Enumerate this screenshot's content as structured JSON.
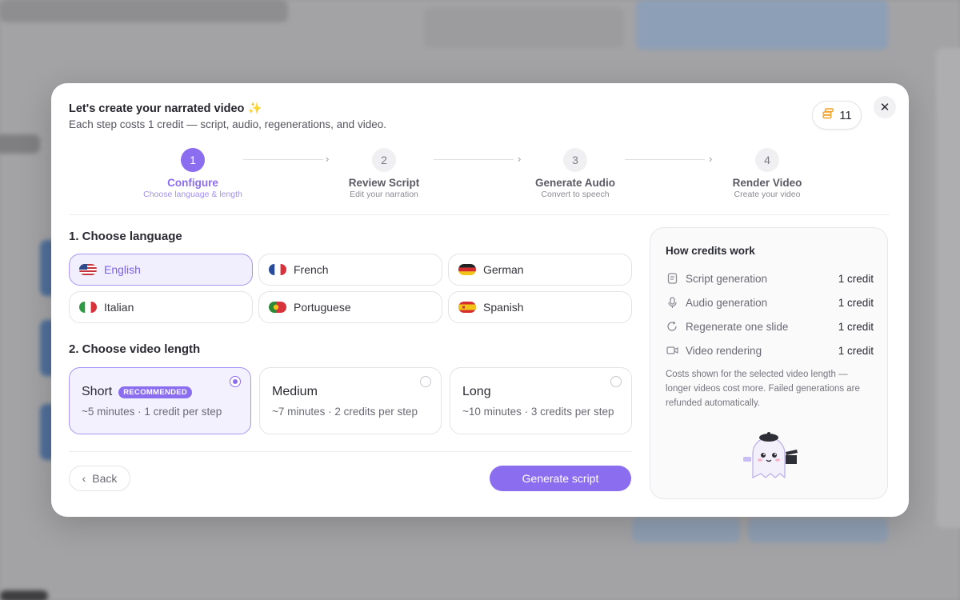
{
  "modal": {
    "title": "Let's create your narrated video ✨",
    "subtitle": "Each step costs 1 credit — script, audio, regenerations, and video.",
    "credits": "11",
    "close_icon": "close-icon"
  },
  "steps": [
    {
      "number": "1",
      "name": "Configure",
      "desc": "Choose language & length",
      "active": true
    },
    {
      "number": "2",
      "name": "Review Script",
      "desc": "Edit your narration",
      "active": false
    },
    {
      "number": "3",
      "name": "Generate Audio",
      "desc": "Convert to speech",
      "active": false
    },
    {
      "number": "4",
      "name": "Render Video",
      "desc": "Create your video",
      "active": false
    }
  ],
  "language": {
    "title": "1. Choose language",
    "options": [
      {
        "label": "English",
        "flag": "us-flag-icon",
        "selected": true
      },
      {
        "label": "French",
        "flag": "fr-flag-icon",
        "selected": false
      },
      {
        "label": "German",
        "flag": "de-flag-icon",
        "selected": false
      },
      {
        "label": "Italian",
        "flag": "it-flag-icon",
        "selected": false
      },
      {
        "label": "Portuguese",
        "flag": "pt-flag-icon",
        "selected": false
      },
      {
        "label": "Spanish",
        "flag": "es-flag-icon",
        "selected": false
      }
    ]
  },
  "length": {
    "title": "2. Choose video length",
    "options": [
      {
        "label": "Short",
        "badge": "RECOMMENDED",
        "desc": "~5 minutes · 1 credit per step",
        "selected": true
      },
      {
        "label": "Medium",
        "desc": "~7 minutes · 2 credits per step",
        "selected": false
      },
      {
        "label": "Long",
        "desc": "~10 minutes · 3 credits per step",
        "selected": false
      }
    ]
  },
  "footer": {
    "back_label": "Back",
    "generate_label": "Generate script"
  },
  "credits_panel": {
    "title": "How credits work",
    "rows": [
      {
        "label": "Script generation",
        "cost": "1 credit",
        "icon": "document-icon"
      },
      {
        "label": "Audio generation",
        "cost": "1 credit",
        "icon": "microphone-icon"
      },
      {
        "label": "Regenerate one slide",
        "cost": "1 credit",
        "icon": "refresh-icon"
      },
      {
        "label": "Video rendering",
        "cost": "1 credit",
        "icon": "video-camera-icon"
      }
    ],
    "note": "Costs shown for the selected video length — longer videos cost more. Failed generations are refunded automatically."
  },
  "colors": {
    "accent": "#8b6df0",
    "selected_bg": "#f1eefd",
    "coin": "#f0a020"
  }
}
